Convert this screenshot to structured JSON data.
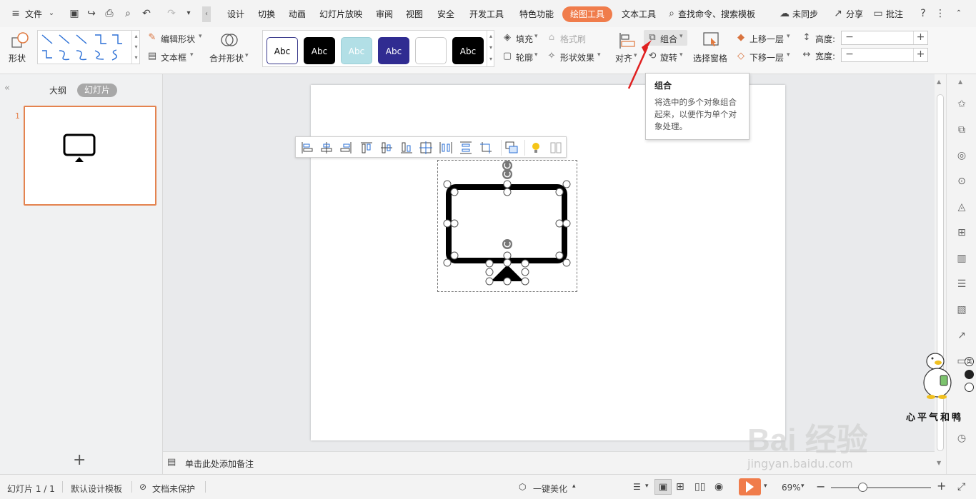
{
  "menubar": {
    "file_menu": "文件",
    "tabs": [
      "设计",
      "切换",
      "动画",
      "幻灯片放映",
      "审阅",
      "视图",
      "安全",
      "开发工具",
      "特色功能"
    ],
    "active_tab": "绘图工具",
    "text_tools_tab": "文本工具",
    "search_label": "查找命令、搜索模板",
    "sync_label": "未同步",
    "share_label": "分享",
    "comment_label": "批注"
  },
  "ribbon": {
    "shape_label": "形状",
    "edit_shape_label": "编辑形状",
    "textbox_label": "文本框",
    "merge_shape_label": "合并形状",
    "style_swatches": [
      {
        "text": "Abc",
        "bg": "#ffffff",
        "fg": "#000000",
        "border": "#3a3a8c"
      },
      {
        "text": "Abc",
        "bg": "#000000",
        "fg": "#ffffff",
        "border": "#000000"
      },
      {
        "text": "Abc",
        "bg": "#b2dfe6",
        "fg": "#ffffff",
        "border": "#9ccfd7"
      },
      {
        "text": "Abc",
        "bg": "#302c91",
        "fg": "#ffffff",
        "border": "#302c91"
      },
      {
        "text": "",
        "bg": "#ffffff",
        "fg": "#000000",
        "border": "#c8c8c8"
      },
      {
        "text": "Abc",
        "bg": "#000000",
        "fg": "#ffffff",
        "border": "#000000"
      }
    ],
    "fill_label": "填充",
    "format_brush_label": "格式刷",
    "outline_label": "轮廓",
    "shape_effect_label": "形状效果",
    "align_label": "对齐",
    "group_label": "组合",
    "rotate_label": "旋转",
    "selection_pane_label": "选择窗格",
    "bring_forward_label": "上移一层",
    "send_backward_label": "下移一层",
    "height_label": "高度:",
    "width_label": "宽度:",
    "height_value": "",
    "width_value": ""
  },
  "tooltip": {
    "title": "组合",
    "body": "将选中的多个对象组合起来，以便作为单个对象处理。"
  },
  "leftpanel": {
    "outline_tab": "大纲",
    "slides_tab": "幻灯片",
    "slide_number": "1",
    "add_slide": "+"
  },
  "notes": {
    "placeholder": "单击此处添加备注"
  },
  "statusbar": {
    "slide_count": "幻灯片 1 / 1",
    "template": "默认设计模板",
    "protection": "文档未保护",
    "beautify": "一键美化",
    "zoom": "69%"
  },
  "watermark": {
    "text": "Bai 经验",
    "url": "jingyan.baidu.com",
    "mascot_text": "心平气和鸭"
  },
  "colors": {
    "accent": "#f07c4b",
    "thumb_border": "#e4834f",
    "red_arrow": "#e02020",
    "play": "#f07c4b"
  }
}
